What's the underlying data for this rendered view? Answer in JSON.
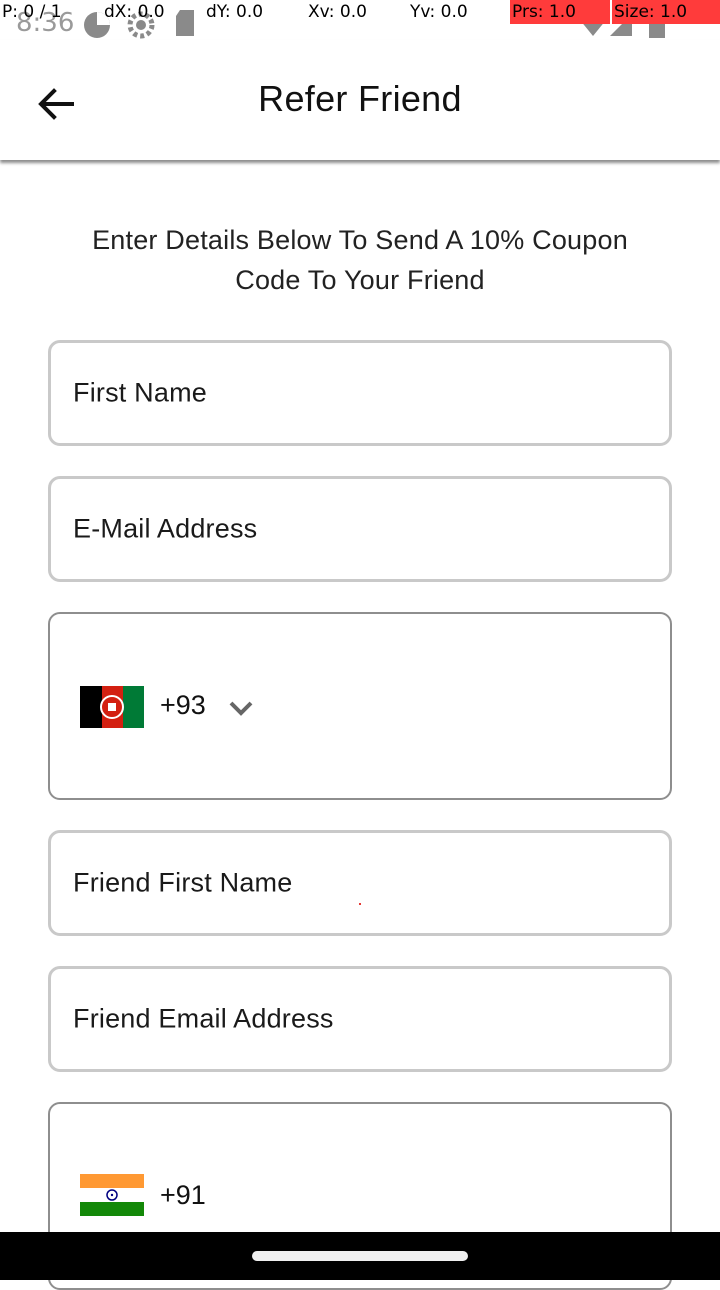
{
  "status_bar": {
    "time": "8:36",
    "icons": [
      "data-sync-icon",
      "settings-icon",
      "sd-card-icon",
      "wifi-icon",
      "signal-icon",
      "battery-icon"
    ]
  },
  "debug_overlay": {
    "pointer": "P: 0 / 1",
    "dx": "dX: 0.0",
    "dy": "dY: 0.0",
    "xv": "Xv: 0.0",
    "yv": "Yv: 0.0",
    "prs": "Prs: 1.0",
    "size": "Size: 1.0",
    "highlight_color": "#ff3b3b"
  },
  "app_bar": {
    "title": "Refer Friend",
    "back_icon": "arrow-left-icon"
  },
  "intro": {
    "text": "Enter Details Below To Send A 10% Coupon Code To Your Friend"
  },
  "form": {
    "first_name": {
      "placeholder": "First Name"
    },
    "email": {
      "placeholder": "E-Mail Address"
    },
    "phone": {
      "country": "Afghanistan",
      "dial_code": "+93",
      "dropdown_icon": "chevron-down-icon"
    },
    "friend_first_name": {
      "placeholder": "Friend First Name"
    },
    "friend_email": {
      "placeholder": "Friend Email Address"
    },
    "friend_phone": {
      "country": "India",
      "dial_code": "+91"
    }
  },
  "colors": {
    "field_border": "#c9c9c9",
    "phone_border": "#8e8e8e",
    "nav_bar": "#000000"
  }
}
